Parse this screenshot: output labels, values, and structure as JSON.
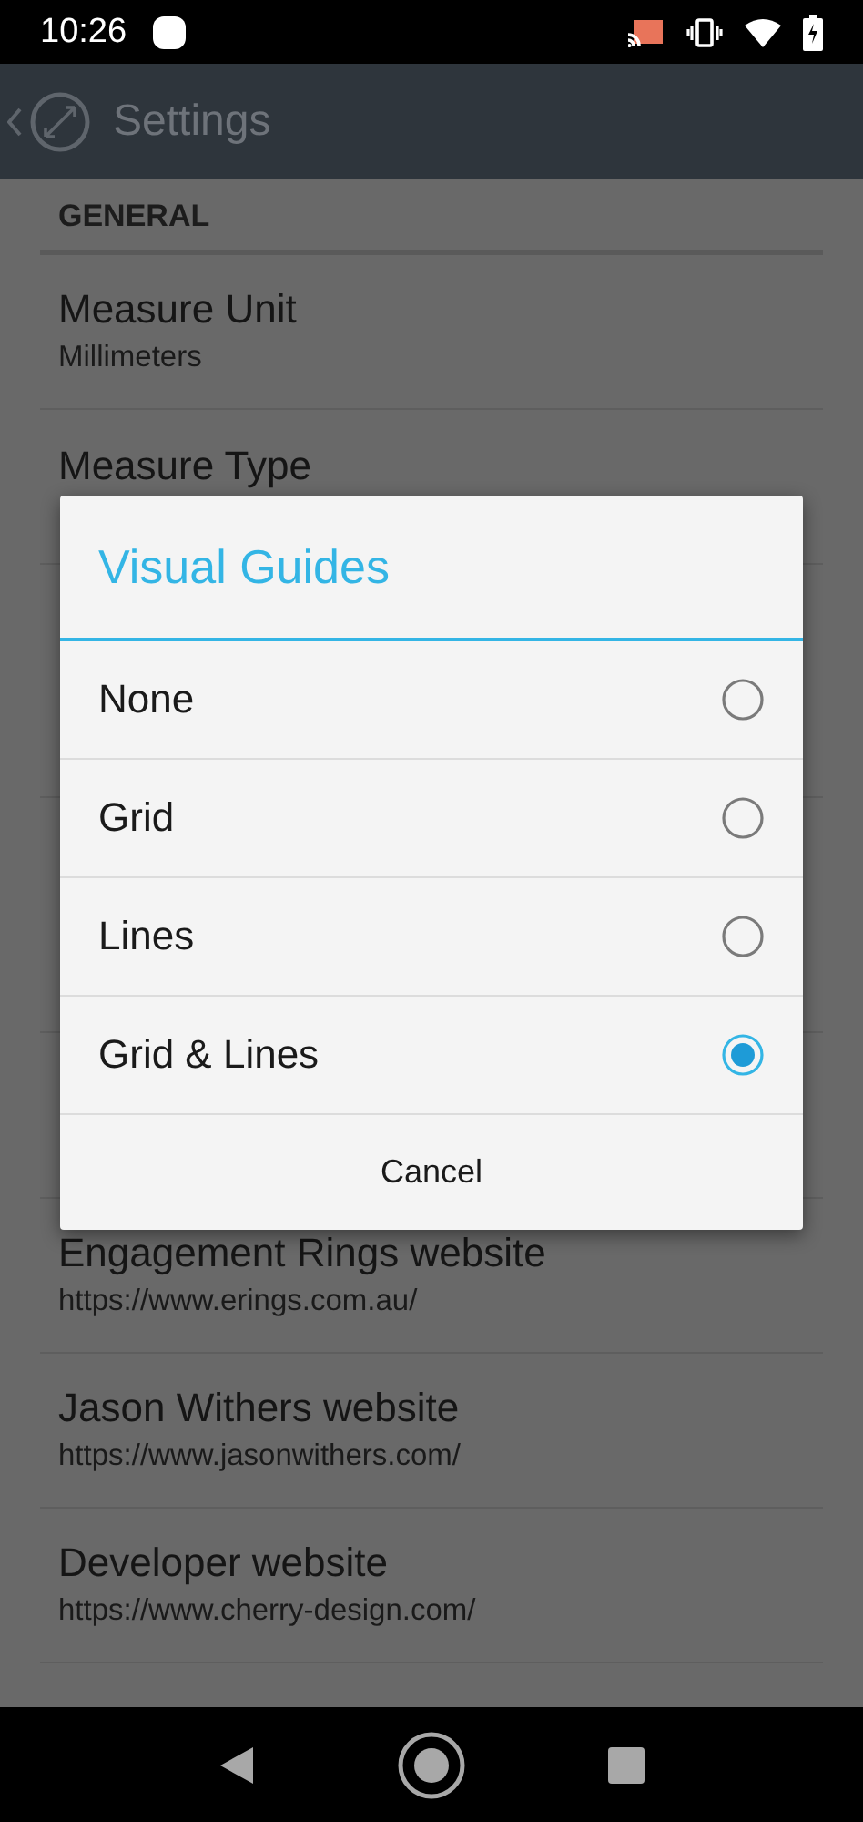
{
  "status_bar": {
    "time": "10:26"
  },
  "app_bar": {
    "title": "Settings"
  },
  "list": [
    {
      "kind": "header",
      "title": "GENERAL"
    },
    {
      "kind": "pref",
      "title": "Measure Unit",
      "summary": "Millimeters"
    },
    {
      "kind": "pref",
      "title": "Measure Type"
    },
    {
      "kind": "pref",
      "title": "Engagement Rings website",
      "summary": "https://www.erings.com.au/"
    },
    {
      "kind": "pref",
      "title": "Jason Withers website",
      "summary": "https://www.jasonwithers.com/"
    },
    {
      "kind": "pref",
      "title": "Developer website",
      "summary": "https://www.cherry-design.com/"
    }
  ],
  "dialog": {
    "title": "Visual Guides",
    "options": [
      {
        "label": "None",
        "selected": false
      },
      {
        "label": "Grid",
        "selected": false
      },
      {
        "label": "Lines",
        "selected": false
      },
      {
        "label": "Grid & Lines",
        "selected": true
      }
    ],
    "cancel": "Cancel"
  }
}
